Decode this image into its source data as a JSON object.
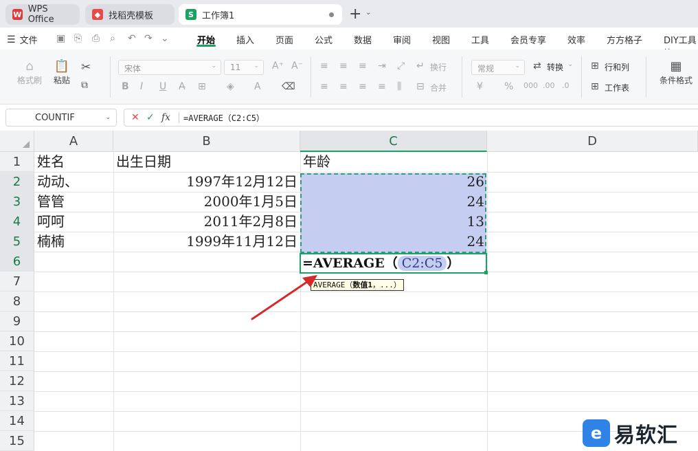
{
  "tabs": [
    {
      "label": "WPS Office"
    },
    {
      "label": "找稻壳模板"
    },
    {
      "label": "工作簿1"
    }
  ],
  "menubar": {
    "file_label": "文件",
    "items": [
      "开始",
      "插入",
      "页面",
      "公式",
      "数据",
      "审阅",
      "视图",
      "工具",
      "会员专享",
      "效率",
      "方方格子",
      "DIY工具箱"
    ],
    "active": "开始"
  },
  "ribbon": {
    "format_painter": "格式刷",
    "paste": "粘贴",
    "font_name": "宋体",
    "font_size": "11",
    "wrap": "换行",
    "merge": "合并",
    "number_format": "常规",
    "convert": "转换",
    "row_col": "行和列",
    "worksheet": "工作表",
    "cond_format": "条件格式"
  },
  "formula_bar": {
    "name_box": "COUNTIF",
    "formula": "=AVERAGE（C2:C5）"
  },
  "sheet": {
    "columns": [
      "A",
      "B",
      "C",
      "D"
    ],
    "rows": [
      "1",
      "2",
      "3",
      "4",
      "5",
      "6",
      "7",
      "8",
      "9",
      "10",
      "11",
      "12",
      "13",
      "14",
      "15"
    ],
    "header_row": {
      "a": "姓名",
      "b": "出生日期",
      "c": "年龄"
    },
    "data": [
      {
        "a": "动动、",
        "b": "1997年12月12日",
        "c": "26"
      },
      {
        "a": "管管",
        "b": "2000年1月5日",
        "c": "24"
      },
      {
        "a": "呵呵",
        "b": "2011年2月8日",
        "c": "13"
      },
      {
        "a": "楠楠",
        "b": "1999年11月12日",
        "c": "24"
      }
    ],
    "edit": {
      "prefix": "=AVERAGE（",
      "ref": "C2:C5",
      "suffix": "）"
    },
    "tooltip": {
      "fn": "AVERAGE（",
      "arg": "数值1",
      "rest": "，...）"
    }
  },
  "watermark": {
    "text": "易软汇"
  },
  "colors": {
    "accent": "#1aa260",
    "selection": "#c5cef0"
  }
}
